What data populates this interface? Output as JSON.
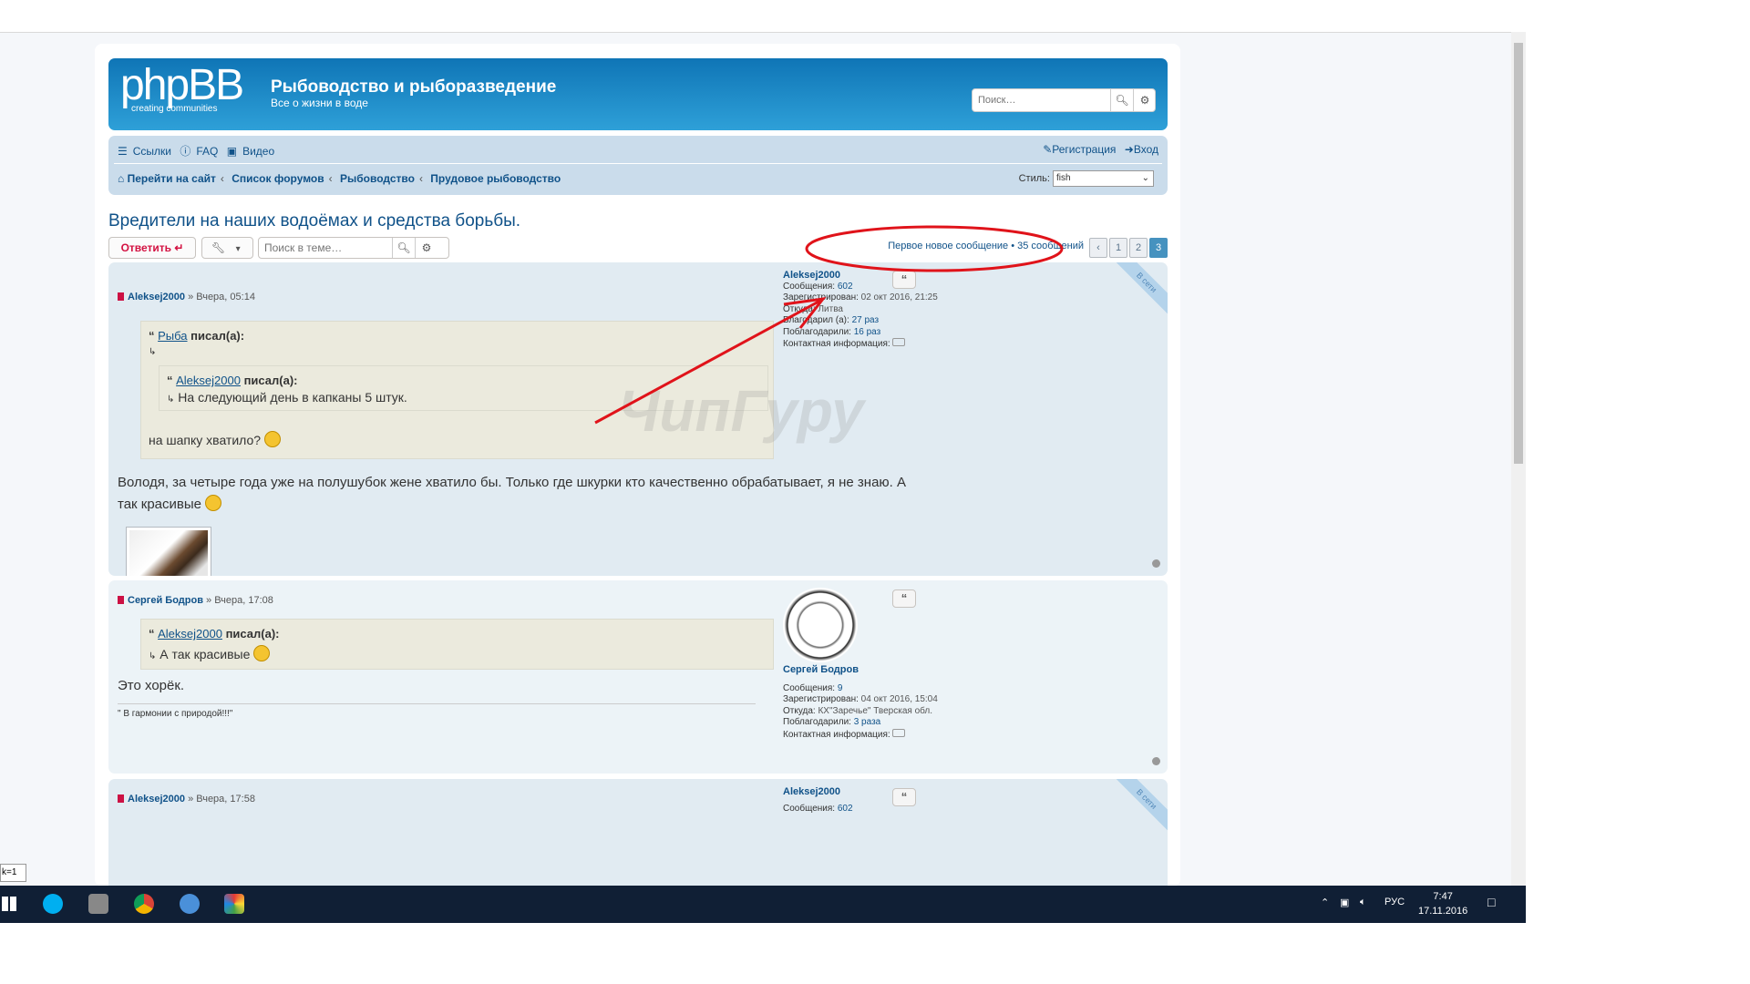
{
  "header": {
    "logo_main": "phpBB",
    "logo_sub": "creating  communities",
    "site_title": "Рыбоводство и рыборазведение",
    "site_desc": "Все о жизни в воде",
    "search_placeholder": "Поиск…"
  },
  "nav": {
    "links": "Ссылки",
    "faq": "FAQ",
    "video": "Видео",
    "register": "Регистрация",
    "login": "Вход",
    "crumbs": [
      "Перейти на сайт",
      "Список форумов",
      "Рыбоводство",
      "Прудовое рыбоводство"
    ],
    "style_label": "Стиль:",
    "style_value": "fish"
  },
  "topic": {
    "title": "Вредители на наших водоёмах и средства борьбы.",
    "reply_label": "Ответить",
    "search_placeholder": "Поиск в теме…",
    "pagination_text": "Первое новое сообщение • 35 сообщений",
    "pages": [
      "1",
      "2",
      "3"
    ],
    "active_page": "3"
  },
  "posts": [
    {
      "author": "Aleksej2000",
      "time": "» Вчера, 05:14",
      "quote_author": "Рыба",
      "quote_says": "писал(а):",
      "nested_quote_author": "Aleksej2000",
      "nested_quote_says": "писал(а):",
      "nested_quote_text": "На следующий день в капканы 5 штук.",
      "quote_reply": "на шапку хватило?",
      "body": "Володя, за четыре года уже на полушубок жене хватило бы. Только где шкурки кто качественно обрабатывает, я не знаю. А так красивые",
      "profile": {
        "name": "Aleksej2000",
        "posts_label": "Сообщения:",
        "posts": "602",
        "reg_label": "Зарегистрирован:",
        "reg": "02 окт 2016, 21:25",
        "from_label": "Откуда:",
        "from": "Литва",
        "thanked_label": "Благодарил (а):",
        "thanked": "27 раз",
        "was_thanked_label": "Поблагодарили:",
        "was_thanked": "16 раз",
        "contact_label": "Контактная информация:",
        "online": "В сети"
      }
    },
    {
      "author": "Сергей Бодров",
      "time": "» Вчера, 17:08",
      "quote_author": "Aleksej2000",
      "quote_says": "писал(а):",
      "quote_text": "А так красивые",
      "body": "Это хорёк.",
      "signature": "\" В гармонии с природой!!!\"",
      "profile": {
        "name": "Сергей Бодров",
        "posts_label": "Сообщения:",
        "posts": "9",
        "reg_label": "Зарегистрирован:",
        "reg": "04 окт 2016, 15:04",
        "from_label": "Откуда:",
        "from": "КХ\"Заречье\" Тверская обл.",
        "was_thanked_label": "Поблагодарили:",
        "was_thanked": "3 раза",
        "contact_label": "Контактная информация:"
      }
    },
    {
      "author": "Aleksej2000",
      "time": "» Вчера, 17:58",
      "profile": {
        "name": "Aleksej2000",
        "posts_label": "Сообщения:",
        "posts": "602",
        "online": "В сети"
      }
    }
  ],
  "watermark": "ЧипГуру",
  "side_tab": "k=1",
  "taskbar": {
    "lang": "РУС",
    "time": "7:47",
    "date": "17.11.2016"
  },
  "colors": {
    "header_dark": "#0f75b6",
    "header_light": "#2ea0d8",
    "nav_bg": "#cadceb",
    "link": "#105289",
    "annotation_red": "#e0131a",
    "taskbar": "#101f35"
  }
}
